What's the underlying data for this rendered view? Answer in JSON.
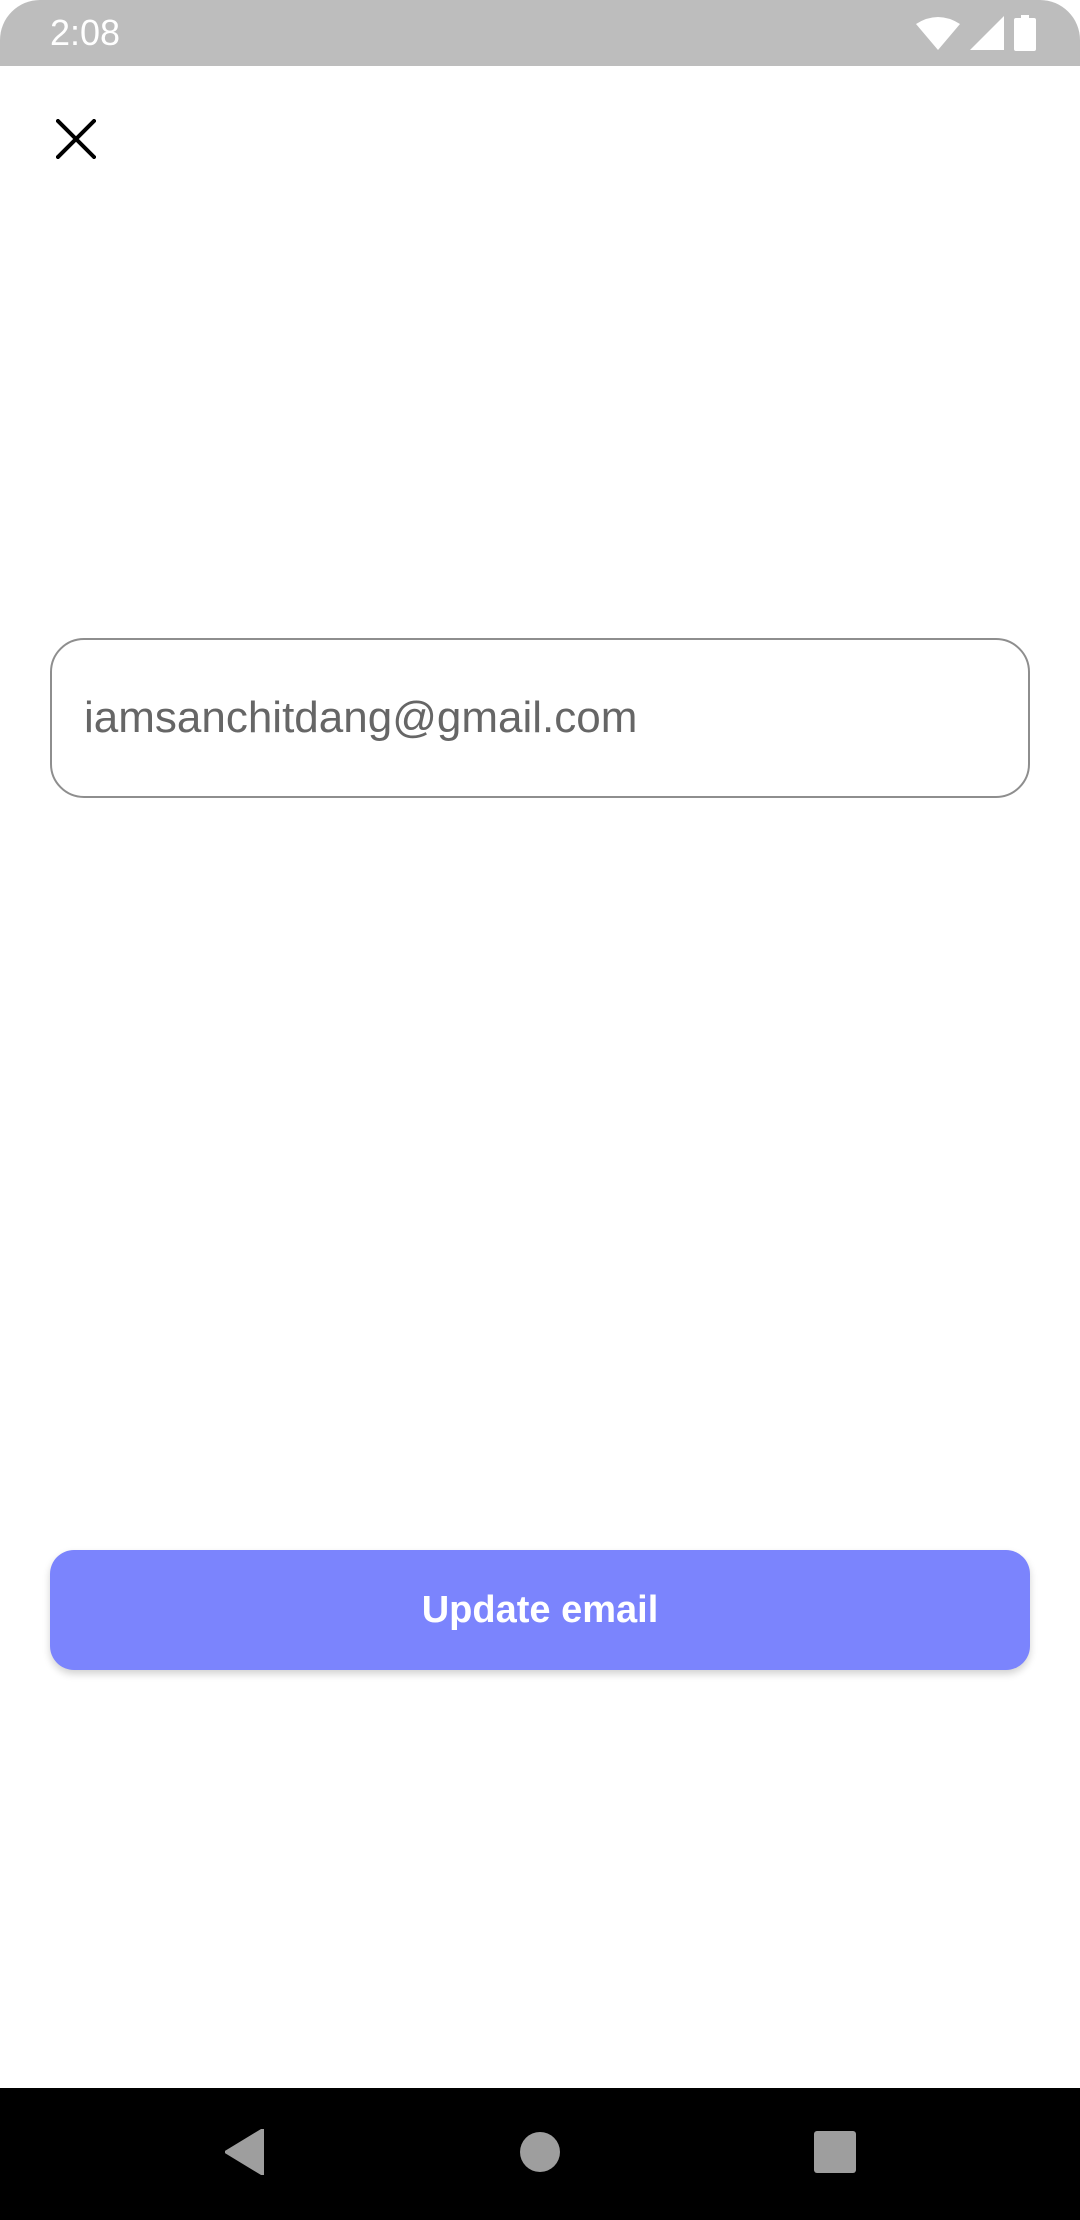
{
  "status_bar": {
    "time": "2:08",
    "icons": [
      "wifi-icon",
      "cell-signal-icon",
      "battery-icon"
    ]
  },
  "toolbar": {
    "close_icon": "close-icon"
  },
  "email_field": {
    "value": "iamsanchitdang@gmail.com"
  },
  "update_button": {
    "label": "Update email",
    "color": "#7b84fd"
  },
  "nav_bar": {
    "buttons": [
      "back-icon",
      "home-icon",
      "recents-icon"
    ]
  }
}
